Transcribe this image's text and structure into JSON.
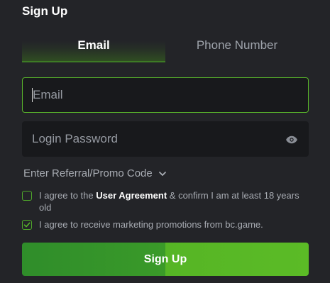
{
  "form": {
    "title": "Sign Up",
    "tabs": [
      {
        "label": "Email",
        "active": true
      },
      {
        "label": "Phone Number",
        "active": false
      }
    ],
    "email_placeholder": "Email",
    "email_value": "",
    "password_placeholder": "Login Password",
    "password_value": "",
    "password_visibility_icon": "eye-icon",
    "referral_label": "Enter Referral/Promo Code",
    "referral_icon": "chevron-down-icon",
    "agreement": {
      "checked": false,
      "prefix": "I agree to the ",
      "link": "User Agreement",
      "suffix": " & confirm I am at least 18 years old"
    },
    "marketing": {
      "checked": true,
      "text": "I agree to receive marketing promotions from bc.game."
    },
    "submit_label": "Sign Up"
  },
  "colors": {
    "background": "#232428",
    "input_bg": "#18191c",
    "accent_green": "#59b62b",
    "muted_text": "#a8acb3"
  }
}
